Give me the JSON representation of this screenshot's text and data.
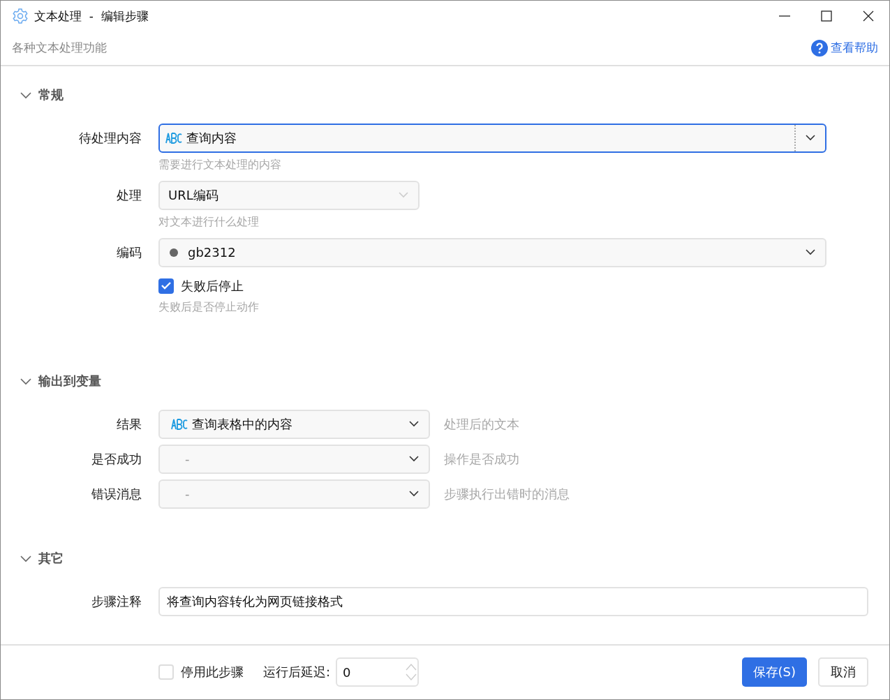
{
  "window": {
    "title": "文本处理  -  编辑步骤"
  },
  "header": {
    "subtitle": "各种文本处理功能",
    "help_link": "查看帮助"
  },
  "sections": [
    {
      "title": "常规",
      "expanded": true,
      "fields": [
        {
          "kind": "variable",
          "label": "待处理内容",
          "value": "查询内容",
          "hint": "需要进行文本处理的内容",
          "focused": true
        },
        {
          "kind": "select",
          "label": "处理",
          "value": "URL编码",
          "hint": "对文本进行什么处理"
        },
        {
          "kind": "dot-select",
          "label": "编码",
          "value": "gb2312"
        },
        {
          "kind": "checkbox",
          "text": "失败后停止",
          "checked": true,
          "hint": "失败后是否停止动作"
        }
      ]
    },
    {
      "title": "输出到变量",
      "expanded": true,
      "fields": [
        {
          "kind": "output",
          "label": "结果",
          "value": "查询表格中的内容",
          "assigned": true,
          "note": "处理后的文本"
        },
        {
          "kind": "output",
          "label": "是否成功",
          "placeholder": "-",
          "assigned": false,
          "note": "操作是否成功"
        },
        {
          "kind": "output",
          "label": "错误消息",
          "placeholder": "-",
          "assigned": false,
          "note": "步骤执行出错时的消息"
        }
      ]
    },
    {
      "title": "其它",
      "expanded": true,
      "fields": [
        {
          "kind": "text",
          "label": "步骤注释",
          "value": "将查询内容转化为网页链接格式"
        }
      ]
    }
  ],
  "footer": {
    "disable": {
      "text": "停用此步骤",
      "checked": false
    },
    "delay": {
      "label": "运行后延迟:",
      "value": "0"
    },
    "buttons": [
      {
        "label": "保存(S)",
        "primary": true
      },
      {
        "label": "取消",
        "primary": false
      }
    ]
  }
}
